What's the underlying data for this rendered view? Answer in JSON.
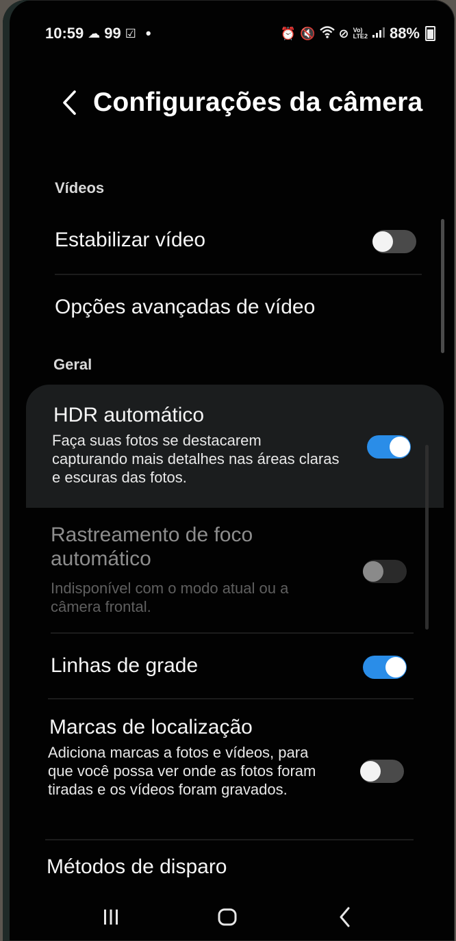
{
  "status_bar": {
    "time": "10:59",
    "notif_count": "99",
    "dot": "•",
    "battery": "88%",
    "icons": [
      "cloud-icon",
      "calendar-check-icon",
      "alarm-icon",
      "mute-icon",
      "wifi-icon",
      "do-not-disturb-icon",
      "volte-icon",
      "signal-icon",
      "battery-icon"
    ]
  },
  "header": {
    "title": "Configurações da câmera",
    "back_icon": "chevron-left-icon"
  },
  "sections": {
    "videos": "Vídeos",
    "general": "Geral"
  },
  "settings": {
    "stabilize": {
      "title": "Estabilizar vídeo",
      "enabled": false
    },
    "advanced_video": {
      "title": "Opções avançadas de vídeo"
    },
    "auto_hdr": {
      "title": "HDR automático",
      "desc": "Faça suas fotos se destacarem capturando mais detalhes nas áreas claras e escuras das fotos.",
      "enabled": true
    },
    "tracking_af": {
      "title": "Rastreamento de foco automático",
      "desc": "Indisponível com o modo atual ou a câmera frontal.",
      "enabled": false,
      "available": false
    },
    "grid_lines": {
      "title": "Linhas de grade",
      "enabled": true
    },
    "location_tags": {
      "title": "Marcas de localização",
      "desc": "Adiciona marcas a fotos e vídeos, para que você possa ver onde as fotos foram tiradas e os vídeos foram gravados.",
      "enabled": false
    },
    "shooting_methods": {
      "title": "Métodos de disparo"
    }
  },
  "nav_bar": {
    "recents_icon": "recents-icon",
    "home_icon": "home-icon",
    "back_icon": "back-icon"
  },
  "colors": {
    "accent": "#2a8de8",
    "background": "#020202",
    "card": "#1b1d1e"
  }
}
